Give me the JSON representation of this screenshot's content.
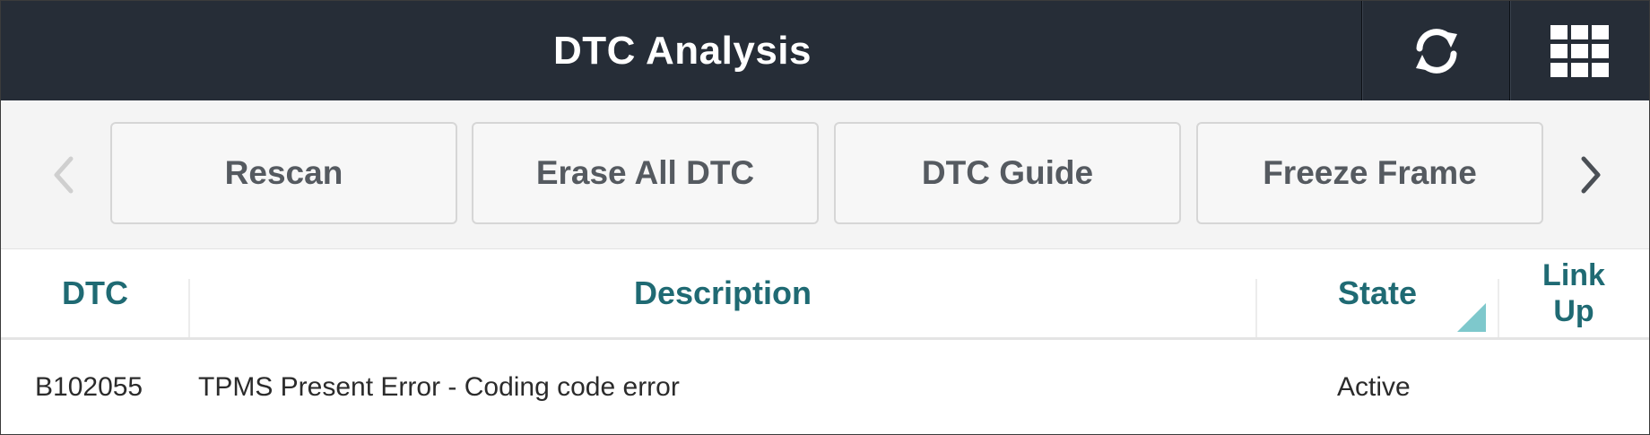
{
  "header": {
    "title": "DTC Analysis",
    "refresh_icon": "refresh-icon",
    "apps_icon": "grid-apps-icon"
  },
  "toolbar": {
    "prev_icon": "chevron-left-icon",
    "next_icon": "chevron-right-icon",
    "buttons": [
      {
        "label": "Rescan"
      },
      {
        "label": "Erase All DTC"
      },
      {
        "label": "DTC Guide"
      },
      {
        "label": "Freeze Frame"
      }
    ]
  },
  "table": {
    "columns": {
      "dtc": "DTC",
      "description": "Description",
      "state": "State",
      "link_up_line1": "Link",
      "link_up_line2": "Up"
    },
    "rows": [
      {
        "dtc": "B102055",
        "description": "TPMS Present Error - Coding code error",
        "state": "Active",
        "link_up": ""
      }
    ]
  },
  "colors": {
    "header_bg": "#262d37",
    "accent_teal": "#1f6a73",
    "sort_indicator": "#7ec8cc"
  }
}
